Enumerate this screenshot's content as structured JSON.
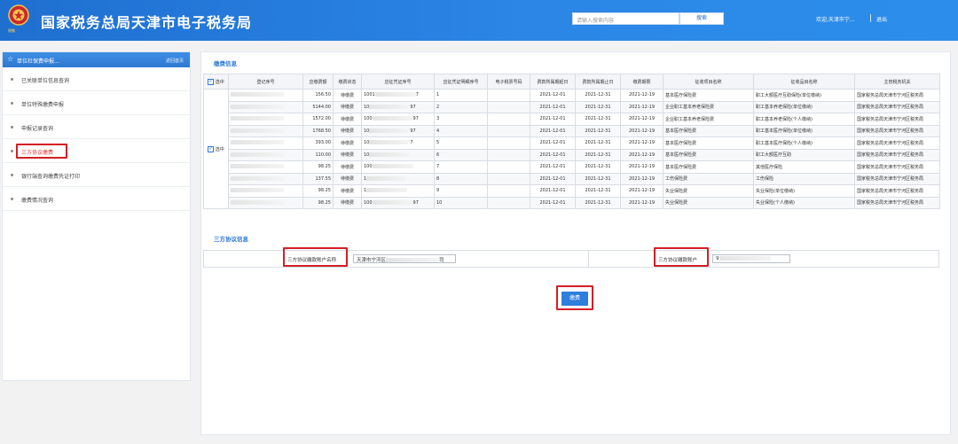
{
  "header": {
    "emblem_text": "税徽",
    "title": "国家税务总局天津市电子税务局",
    "search_placeholder": "请输入搜索内容",
    "search_button": "搜索",
    "welcome": "欢迎,天津市宁...",
    "logout": "退出"
  },
  "sidebar": {
    "title": "单位社保费申报...",
    "back": "返回首页",
    "items": [
      {
        "label": "已关联单位信息查询"
      },
      {
        "label": "单位特殊缴费申报"
      },
      {
        "label": "申报记录查询"
      },
      {
        "label": "三方协议缴费"
      },
      {
        "label": "银行端查询缴费凭证打印"
      },
      {
        "label": "缴费情况查询"
      }
    ]
  },
  "main": {
    "section_payment": "缴费信息",
    "section_agreement": "三方协议信息",
    "select_all_label": "选中",
    "row_select_label": "选中",
    "columns": [
      "登记序号",
      "应缴费额",
      "缴费状态",
      "应征凭证序号",
      "应征凭证明细序号",
      "电子税票号码",
      "费款所属期起日",
      "费款所属期止日",
      "缴费期限",
      "征收项目名称",
      "征收品目名称",
      "主管税务机关"
    ],
    "rows": [
      {
        "amount": "156.50",
        "status": "待缴费",
        "voucher": "1001",
        "voucher_tail": "7",
        "detail": "1",
        "start": "2021-12-01",
        "end": "2021-12-31",
        "deadline": "2021-12-19",
        "item": "基本医疗保险费",
        "sub": "职工大额医疗互助保险(单位缴纳)",
        "office": "国家税务总局天津市宁河区税务局"
      },
      {
        "amount": "5144.00",
        "status": "待缴费",
        "voucher": "10",
        "voucher_tail": "97",
        "detail": "2",
        "start": "2021-12-01",
        "end": "2021-12-31",
        "deadline": "2021-12-19",
        "item": "企业职工基本养老保险费",
        "sub": "职工基本养老保险(单位缴纳)",
        "office": "国家税务总局天津市宁河区税务局"
      },
      {
        "amount": "1572.00",
        "status": "待缴费",
        "voucher": "100",
        "voucher_tail": "97",
        "detail": "3",
        "start": "2021-12-01",
        "end": "2021-12-31",
        "deadline": "2021-12-19",
        "item": "企业职工基本养老保险费",
        "sub": "职工基本养老保险(个人缴纳)",
        "office": "国家税务总局天津市宁河区税务局"
      },
      {
        "amount": "1768.50",
        "status": "待缴费",
        "voucher": "10",
        "voucher_tail": "97",
        "detail": "4",
        "start": "2021-12-01",
        "end": "2021-12-31",
        "deadline": "2021-12-19",
        "item": "基本医疗保险费",
        "sub": "职工基本医疗保险(单位缴纳)",
        "office": "国家税务总局天津市宁河区税务局"
      },
      {
        "amount": "393.00",
        "status": "待缴费",
        "voucher": "10",
        "voucher_tail": "7",
        "detail": "5",
        "start": "2021-12-01",
        "end": "2021-12-31",
        "deadline": "2021-12-19",
        "item": "基本医疗保险费",
        "sub": "职工基本医疗保险(个人缴纳)",
        "office": "国家税务总局天津市宁河区税务局"
      },
      {
        "amount": "110.00",
        "status": "待缴费",
        "voucher": "10",
        "voucher_tail": "",
        "detail": "6",
        "start": "2021-12-01",
        "end": "2021-12-31",
        "deadline": "2021-12-19",
        "item": "基本医疗保险费",
        "sub": "职工大额医疗互助",
        "office": "国家税务总局天津市宁河区税务局"
      },
      {
        "amount": "98.25",
        "status": "待缴费",
        "voucher": "100",
        "voucher_tail": "",
        "detail": "7",
        "start": "2021-12-01",
        "end": "2021-12-31",
        "deadline": "2021-12-19",
        "item": "基本医疗保险费",
        "sub": "其他医疗保险",
        "office": "国家税务总局天津市宁河区税务局"
      },
      {
        "amount": "137.55",
        "status": "待缴费",
        "voucher": "1",
        "voucher_tail": "",
        "detail": "8",
        "start": "2021-12-01",
        "end": "2021-12-31",
        "deadline": "2021-12-19",
        "item": "工伤保险费",
        "sub": "工伤保险",
        "office": "国家税务总局天津市宁河区税务局"
      },
      {
        "amount": "98.25",
        "status": "待缴费",
        "voucher": "1",
        "voucher_tail": "",
        "detail": "9",
        "start": "2021-12-01",
        "end": "2021-12-31",
        "deadline": "2021-12-19",
        "item": "失业保险费",
        "sub": "失业保险(单位缴纳)",
        "office": "国家税务总局天津市宁河区税务局"
      },
      {
        "amount": "98.25",
        "status": "待缴费",
        "voucher": "100",
        "voucher_tail": "97",
        "detail": "10",
        "start": "2021-12-01",
        "end": "2021-12-31",
        "deadline": "2021-12-19",
        "item": "失业保险费",
        "sub": "失业保险(个人缴纳)",
        "office": "国家税务总局天津市宁河区税务局"
      }
    ],
    "agreement": {
      "account_name_label": "三方协议缴款账户名称",
      "account_name_prefix": "天津市宁河区",
      "account_name_suffix": "司",
      "account_no_label": "三方协议缴款账户",
      "account_no_prefix": "9"
    },
    "pay_button": "缴费"
  },
  "colors": {
    "brand_blue": "#2e79d2",
    "highlight_red": "#d31f26"
  }
}
